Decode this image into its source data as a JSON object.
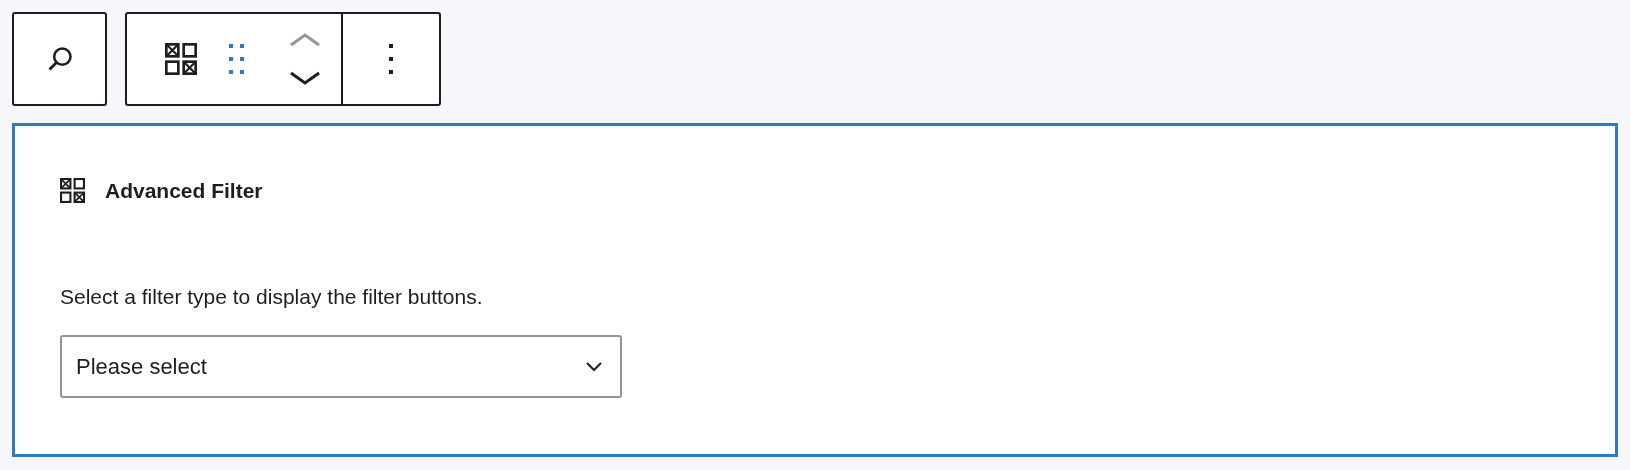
{
  "toolbar": {
    "move_up": {
      "disabled": true
    },
    "move_down": {
      "disabled": false
    }
  },
  "block": {
    "title": "Advanced Filter",
    "description": "Select a filter type to display the filter buttons.",
    "select": {
      "value": "Please select"
    }
  }
}
